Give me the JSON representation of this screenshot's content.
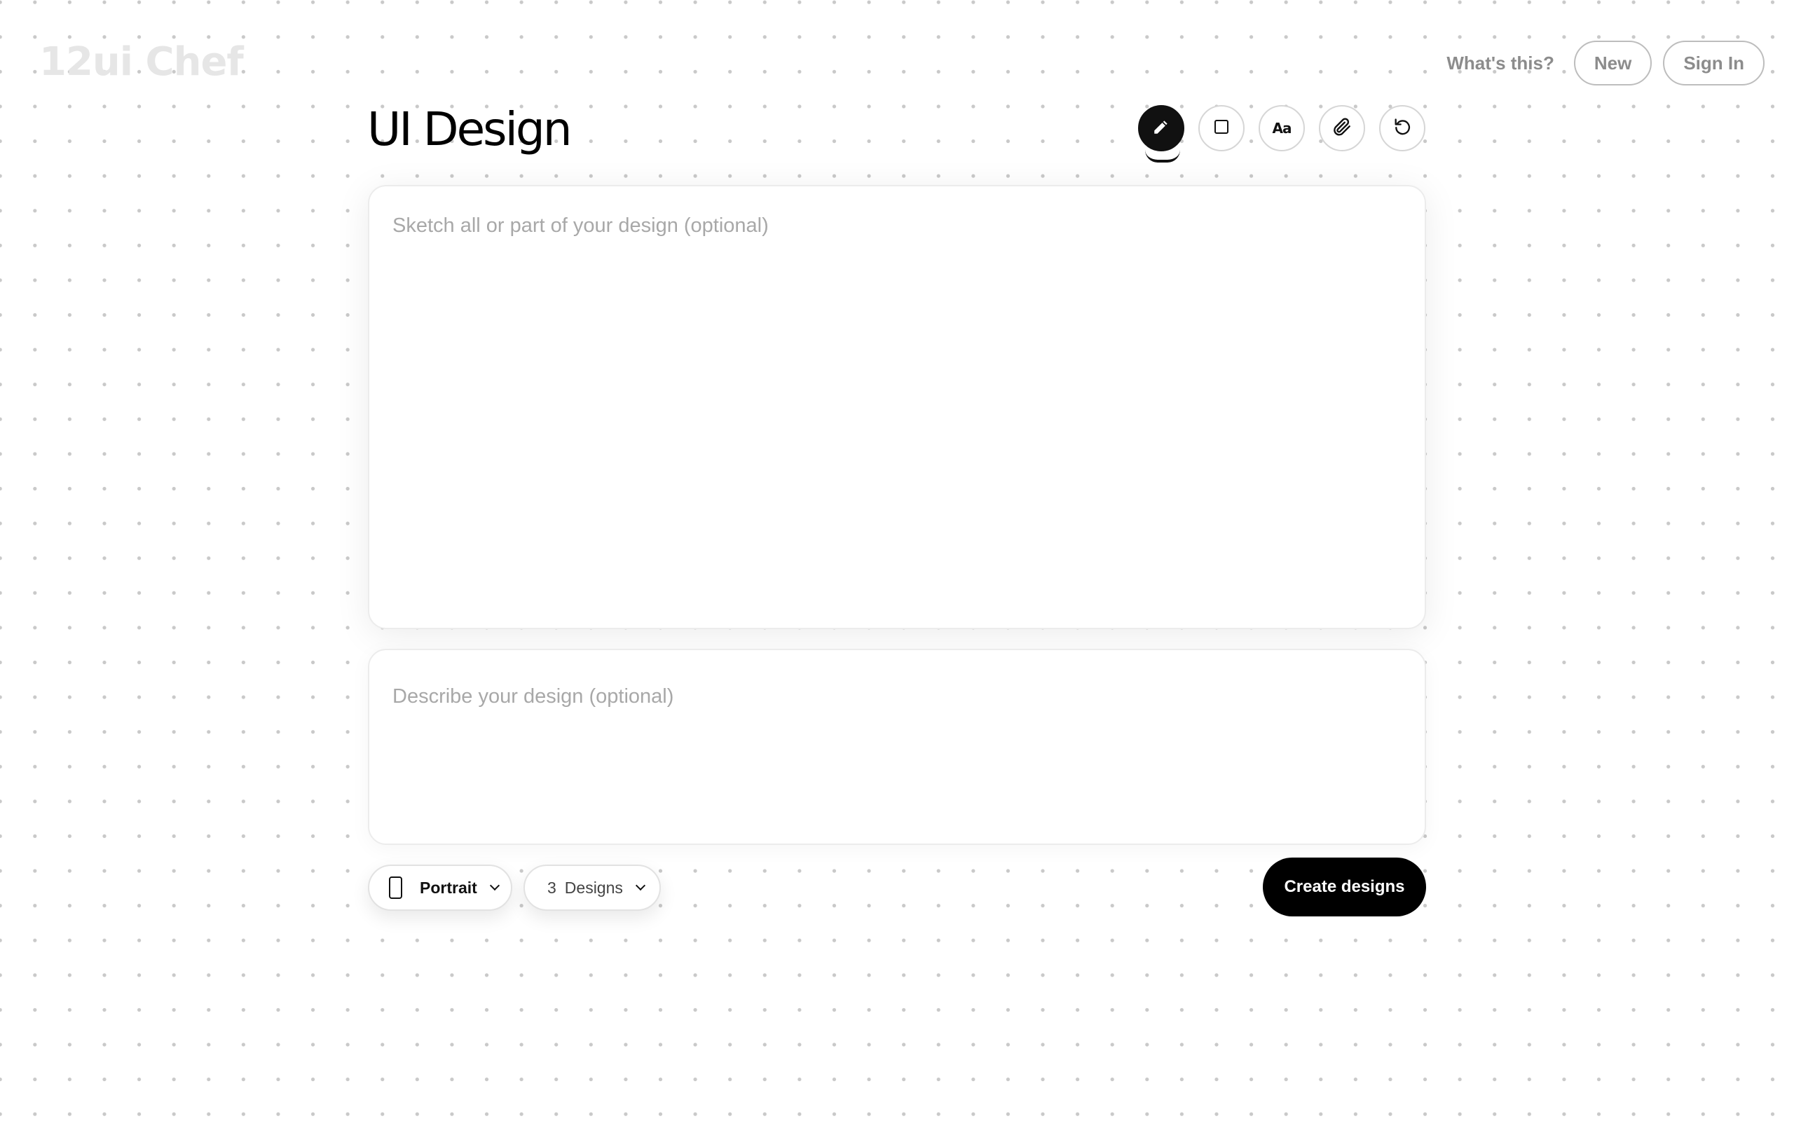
{
  "brand": {
    "name": "12ui Chef"
  },
  "nav": {
    "whats_this": "What's this?",
    "new_label": "New",
    "sign_in_label": "Sign In"
  },
  "page": {
    "title": "UI Design"
  },
  "toolbar": {
    "tools": [
      {
        "name": "pencil-icon",
        "active": true
      },
      {
        "name": "rectangle-icon",
        "active": false
      },
      {
        "name": "text-icon",
        "label": "Aa",
        "active": false
      },
      {
        "name": "paperclip-icon",
        "active": false
      },
      {
        "name": "undo-icon",
        "active": false
      }
    ]
  },
  "sketch": {
    "placeholder": "Sketch all or part of your design (optional)"
  },
  "describe": {
    "placeholder": "Describe your design (optional)"
  },
  "controls": {
    "orientation": {
      "icon": "phone-portrait-icon",
      "label": "Portrait"
    },
    "designs": {
      "count": "3",
      "unit": "Designs"
    }
  },
  "actions": {
    "create_label": "Create designs"
  },
  "colors": {
    "accent": "#000000",
    "muted_text": "#8c8c8c",
    "placeholder": "#a8a8a8",
    "brand_watermark": "#e6e6e6"
  }
}
